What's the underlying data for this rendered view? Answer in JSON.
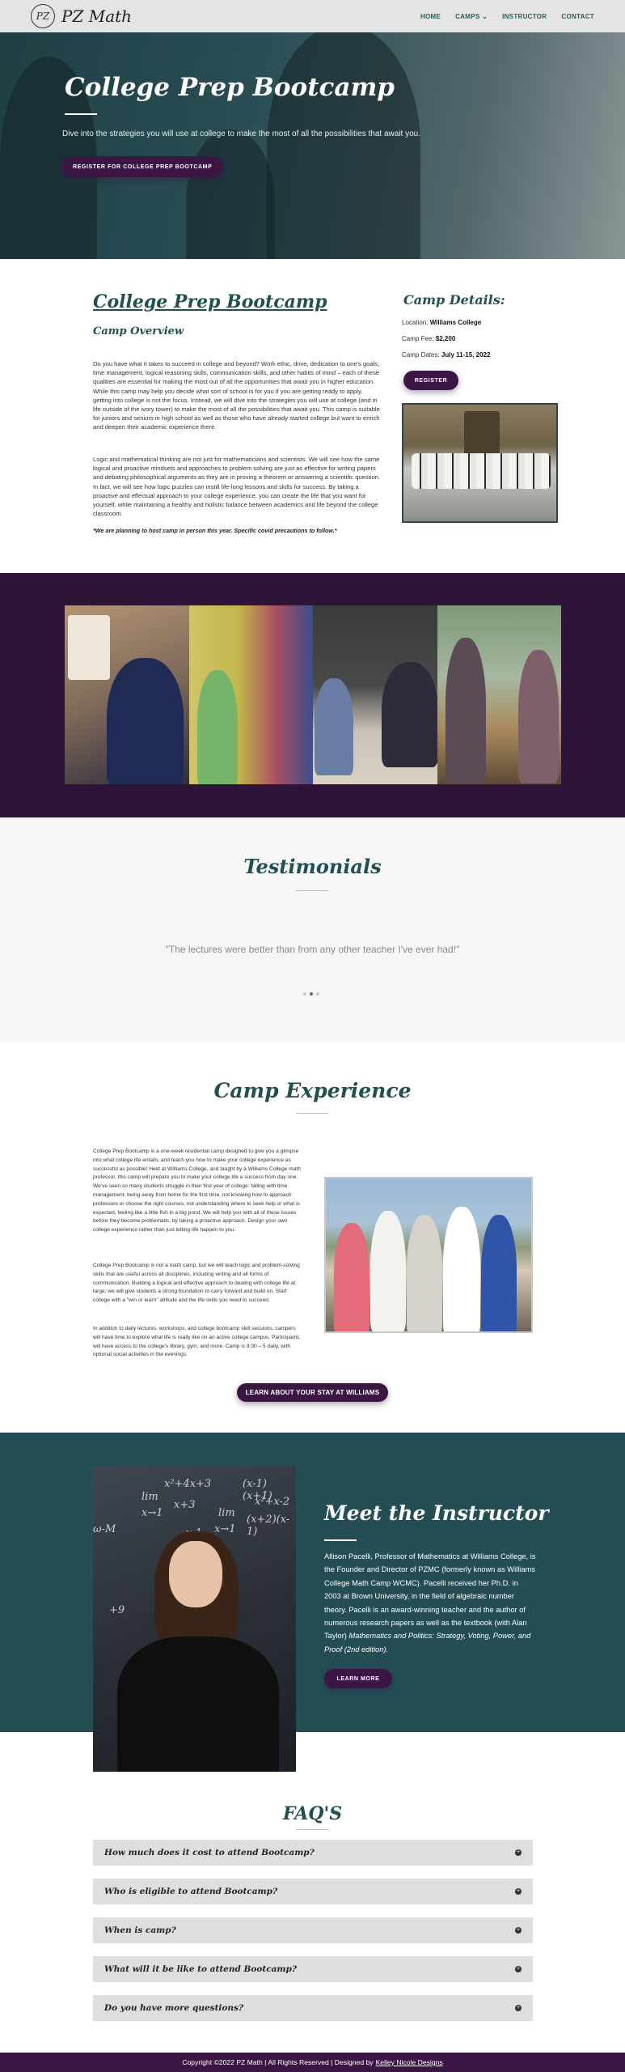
{
  "nav": {
    "logo_mark": "PZ",
    "logo_text": "PZ Math",
    "items": [
      "HOME",
      "CAMPS",
      "INSTRUCTOR",
      "CONTACT"
    ],
    "camps_chevron": "⌄"
  },
  "hero": {
    "title": "College Prep Bootcamp",
    "subtitle": "Dive into the strategies you will use at college to make the most of all the possibilities that await you.",
    "button": "REGISTER FOR COLLEGE PREP BOOTCAMP"
  },
  "college_prep": {
    "title": "College Prep Bootcamp",
    "overview_heading": "Camp Overview",
    "paragraph1": "Do you have what it takes to succeed in college and beyond? Work ethic, drive, dedication to one's goals, time management, logical reasoning skills, communication skills, and other habits of mind – each of these qualities are essential for making the most out of all the opportunities that await you in higher education. While this camp may help you decide what sort of school is for you if you are getting ready to apply, getting into college is not the focus. Instead, we will dive into the strategies you will use at college (and in life outside of the ivory tower) to make the most of all the possibilities that await you. This camp is suitable for juniors and seniors in high school as well as those who have already started college but want to enrich and deepen their academic experience there.",
    "paragraph2": "Logic and mathematical thinking are not just for mathematicians and scientists. We will see how the same logical and proactive mindsets and approaches to problem solving are just as effective for writing papers and debating philosophical arguments as they are in proving a theorem or answering a scientific question. In fact, we will see how logic puzzles can instill life-long lessons and skills for success. By taking a proactive and effectual approach to your college experience, you can create the life that you want for yourself, while maintaining a healthy and holistic balance between academics and life beyond the college classroom.",
    "note": "*We are planning to host camp in person this year. Specific covid precautions to follow.*"
  },
  "camp_details": {
    "title": "Camp Details:",
    "location_label": "Location:",
    "location": "Williams College",
    "fee_label": "Camp Fee:",
    "fee": "$2,200",
    "dates_label": "Camp Dates:",
    "dates": "July 11-15, 2022",
    "register": "REGISTER"
  },
  "testimonials": {
    "title": "Testimonials",
    "quote": "\"The lectures were better than from any other teacher I've ever had!\""
  },
  "camp_experience": {
    "title": "Camp Experience",
    "paragraph1": "College Prep Bootcamp is a one-week residential camp designed to give you a glimpse into what college life entails, and teach you how to make your college experience as successful as possible! Held at Williams College, and taught by a Williams College math professor, this camp will prepare you to make your college life a success from day one. We've seen so many students struggle in their first year of college: falling with time management, being away from home for the first time, not knowing how to approach professors or choose the right courses, not understanding where to seek help or what is expected, feeling like a little fish in a big pond. We will help you with all of these issues before they become problematic, by taking a proactive approach. Design your own college experience rather than just letting life happen to you.",
    "paragraph2": "College Prep Bootcamp is not a math camp, but we will teach logic and problem-solving skills that are useful across all disciplines, including writing and all forms of communication. Building a logical and effective approach to dealing with college life at large, we will give students a strong foundation to carry forward and build on. Start college with a \"win or learn\" attitude and the life skills you need to succeed.",
    "paragraph3": "In addition to daily lectures, workshops, and college bootcamp skill sessions, campers will have time to explore what life is really like on an active college campus. Participants will have access to the college's library, gym, and more. Camp is 9:30 – 5 daily, with optional social activities in the evenings.",
    "button": "LEARN ABOUT YOUR STAY AT WILLIAMS"
  },
  "instructor": {
    "title": "Meet the Instructor",
    "bio": "Allison Pacelli, Professor of Mathematics at Williams College, is the Founder and Director of PZMC (formerly known as Williams College Math Camp WCMC). Pacelli received her Ph.D. in 2003 at Brown University, in the field of algebraic number theory. Pacelli is an award-winning teacher and the author of numerous research papers as well as the textbook (with Alan Taylor)",
    "book": "Mathematics and Politics: Strategy, Voting, Power, and Proof (2nd edition).",
    "button": "LEARN MORE",
    "chalk": [
      "lim",
      "x²+4x+3",
      "x+3",
      "(x-1)(x+1)",
      "lim",
      "x²+x-2",
      "x→1",
      "(x+2)(x-1)",
      "x→1",
      "x-1",
      "+9",
      "ω-M"
    ]
  },
  "faq": {
    "title": "FAQ'S",
    "items": [
      "How much does it cost to attend Bootcamp?",
      "Who is eligible to attend Bootcamp?",
      "When is camp?",
      "What will it be like to attend Bootcamp?",
      "Do you have more questions?"
    ]
  },
  "footer": {
    "text": "Copyright ©2022 PZ Math | All Rights Reserved | Designed by",
    "designer": "Kelley Nicole Designs"
  },
  "colors": {
    "teal": "#22504f",
    "purple": "#3b1544",
    "instructor_bg": "#244d54"
  }
}
